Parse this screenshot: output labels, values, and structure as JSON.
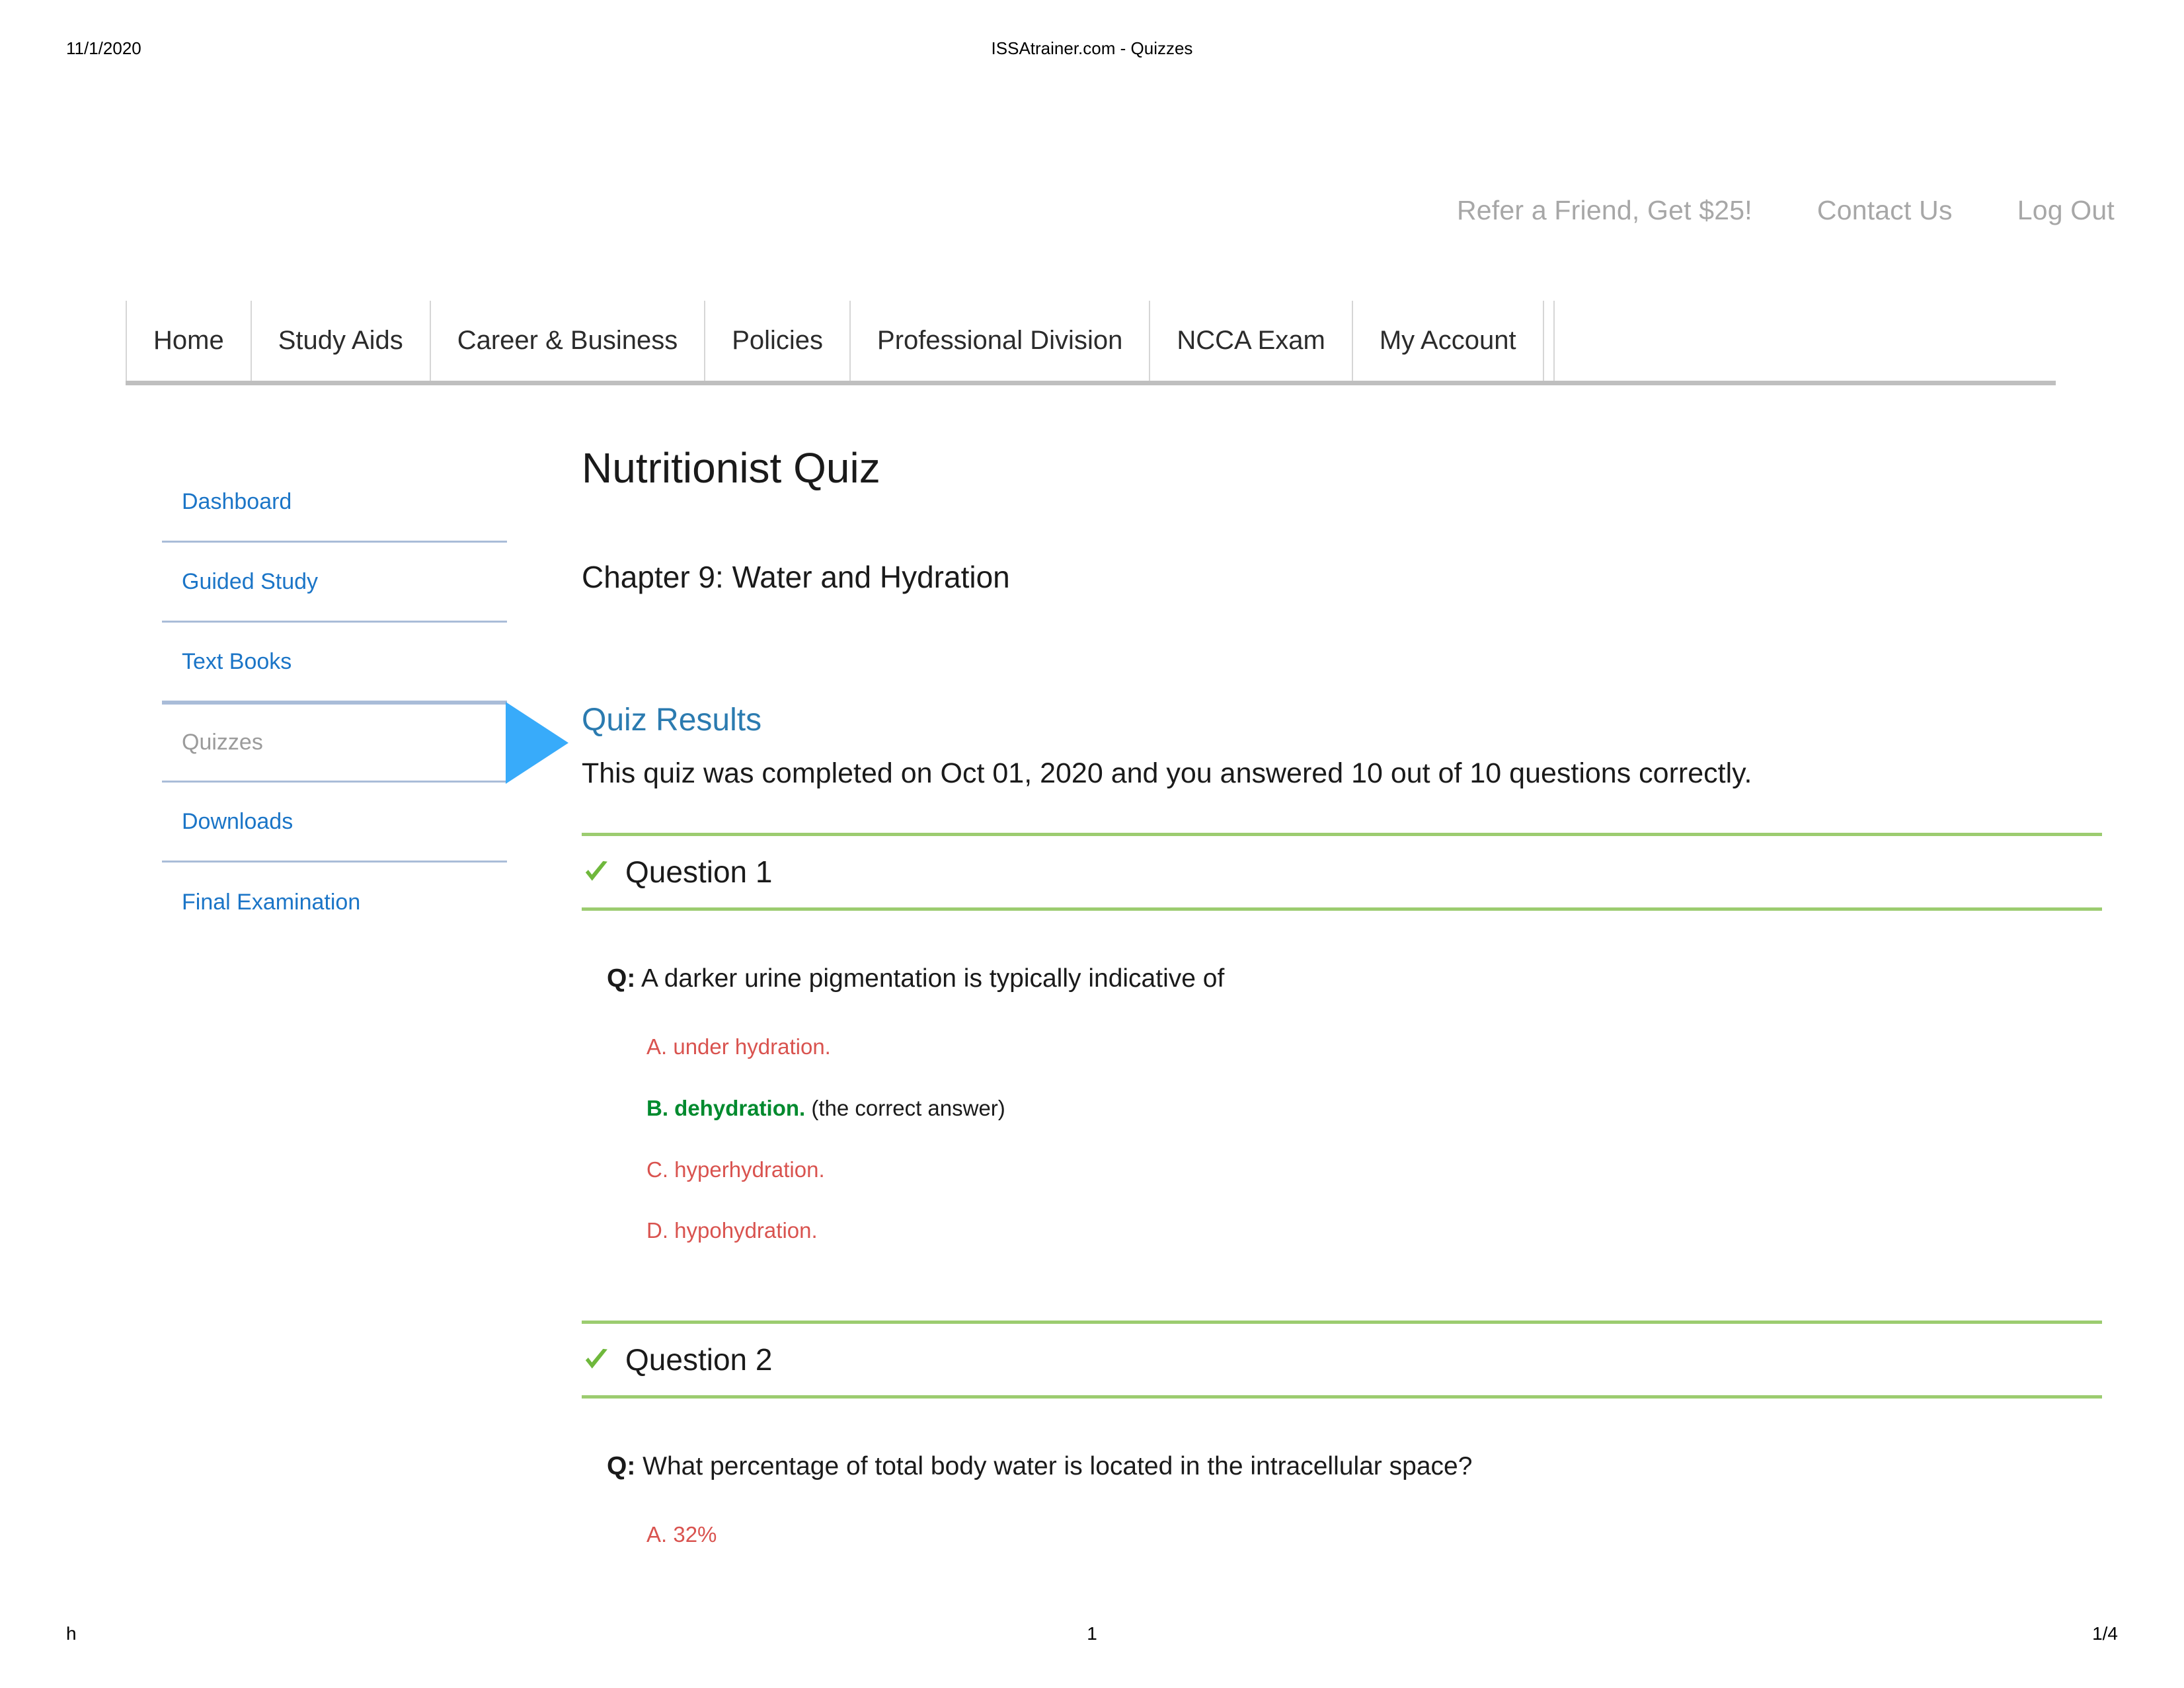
{
  "print_header": {
    "date": "11/1/2020",
    "title": "ISSAtrainer.com - Quizzes"
  },
  "utility_nav": {
    "items": [
      {
        "label": "Refer a Friend, Get $25!"
      },
      {
        "label": "Contact Us"
      },
      {
        "label": "Log Out"
      }
    ]
  },
  "main_nav": {
    "items": [
      {
        "label": "Home"
      },
      {
        "label": "Study Aids"
      },
      {
        "label": "Career & Business"
      },
      {
        "label": "Policies"
      },
      {
        "label": "Professional Division"
      },
      {
        "label": "NCCA Exam"
      },
      {
        "label": "My Account"
      }
    ]
  },
  "sidebar": {
    "items": [
      {
        "label": "Dashboard",
        "active": false
      },
      {
        "label": "Guided Study",
        "active": false
      },
      {
        "label": "Text Books",
        "active": false
      },
      {
        "label": "Quizzes",
        "active": true
      },
      {
        "label": "Downloads",
        "active": false
      },
      {
        "label": "Final Examination",
        "active": false
      }
    ]
  },
  "main": {
    "quiz_title": "Nutritionist Quiz",
    "chapter_title": "Chapter 9: Water and Hydration",
    "results_heading": "Quiz Results",
    "results_text": "This quiz was completed on Oct 01, 2020 and you answered 10 out of 10 questions correctly.",
    "completed_date": "Oct 01, 2020",
    "correct_count": "10",
    "total_questions": "10",
    "question_prefix": "Q:",
    "correct_answer_note": "(the correct answer)",
    "check_icon": "check-mark-icon",
    "questions": [
      {
        "label": "Question 1",
        "status_icon": "check-mark-icon",
        "text": "A darker urine pigmentation is typically indicative of",
        "answers": [
          {
            "text": "A. under hydration.",
            "correct": false
          },
          {
            "text": "B. dehydration.",
            "correct": true
          },
          {
            "text": "C. hyperhydration.",
            "correct": false
          },
          {
            "text": "D. hypohydration.",
            "correct": false
          }
        ]
      },
      {
        "label": "Question 2",
        "status_icon": "check-mark-icon",
        "text": "What percentage of total body water is located in the intracellular space?",
        "answers": [
          {
            "text": "A. 32%",
            "correct": false
          }
        ]
      }
    ]
  },
  "print_footer": {
    "left": "h",
    "center": "1",
    "right": "1/4"
  },
  "colors": {
    "link_blue": "#1b75c7",
    "heading_blue": "#2b7bb0",
    "pointer_blue": "#38abfa",
    "divider_green": "#9ccc70",
    "correct_green": "#008a2e",
    "incorrect_red": "#d9534f",
    "muted_gray": "#a7a7a7",
    "nav_border": "#bfbfbf"
  }
}
